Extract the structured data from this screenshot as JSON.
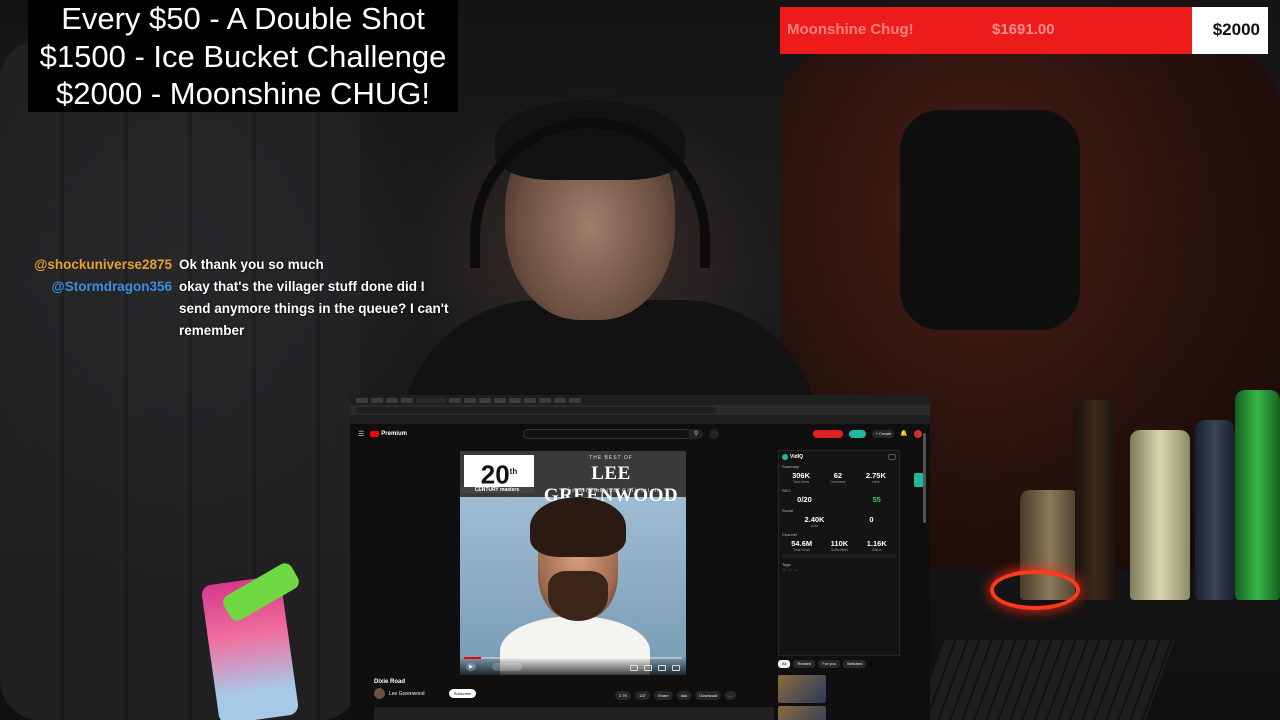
{
  "goals_overlay": {
    "lines": [
      "Every $50 - A Double Shot",
      "$1500 - Ice Bucket Challenge",
      "$2000 - Moonshine CHUG!"
    ]
  },
  "goal_bar": {
    "name": "Moonshine Chug!",
    "current_text": "$1691.00",
    "target_text": "$2000",
    "current_value": 1691,
    "target_value": 2000,
    "fill_fraction": 0.845,
    "colors": {
      "fill": "#ee1b1b",
      "track": "#ffffff"
    }
  },
  "chat": [
    {
      "user": "@shockuniverse2875",
      "user_color": "#e6a030",
      "message": "Ok thank you so much"
    },
    {
      "user": "@Stormdragon356",
      "user_color": "#3a8fe0",
      "message": "okay that's the villager stuff done did I send anymore things in the queue? I can't remember"
    }
  ],
  "browser": {
    "youtube": {
      "logo_text": "Premium",
      "create_label": "+ Create"
    },
    "player": {
      "album": {
        "badge": "20",
        "badge_sup": "th",
        "badge_sub": "CENTURY masters",
        "best_of": "THE BEST OF",
        "artist": "LEE GREENWOOD",
        "subtitle": "The Millennium Collection"
      },
      "progress_fraction": 0.08
    },
    "video": {
      "title": "Dixie Road",
      "channel": "Lee Greenwood",
      "subscribe": "Subscribe",
      "actions": [
        "2.7K",
        "137",
        "Share",
        "Ask",
        "Download",
        "..."
      ]
    },
    "vidiq": {
      "brand": "VidIQ",
      "summary_label": "Summary",
      "summary": [
        {
          "value": "306K",
          "label": "Total Views"
        },
        {
          "value": "62",
          "label": "Comments"
        },
        {
          "value": "2.75K",
          "label": "Likes"
        }
      ],
      "seo_label": "SEO",
      "seo": [
        {
          "value": "0/20",
          "label": ""
        },
        {
          "value": "",
          "label": ""
        },
        {
          "value": "55",
          "label": ""
        }
      ],
      "social_label": "Social",
      "social": [
        {
          "value": "2.40K",
          "label": "Likes"
        },
        {
          "value": "0",
          "label": ""
        }
      ],
      "channel_label": "Channel",
      "channel": [
        {
          "value": "54.6M",
          "label": "Total Views"
        },
        {
          "value": "110K",
          "label": "Subscribers"
        },
        {
          "value": "1.16K",
          "label": "Videos"
        }
      ],
      "tags_label": "Tags"
    },
    "chips": [
      "All",
      "Related",
      "For you",
      "Watched"
    ]
  }
}
